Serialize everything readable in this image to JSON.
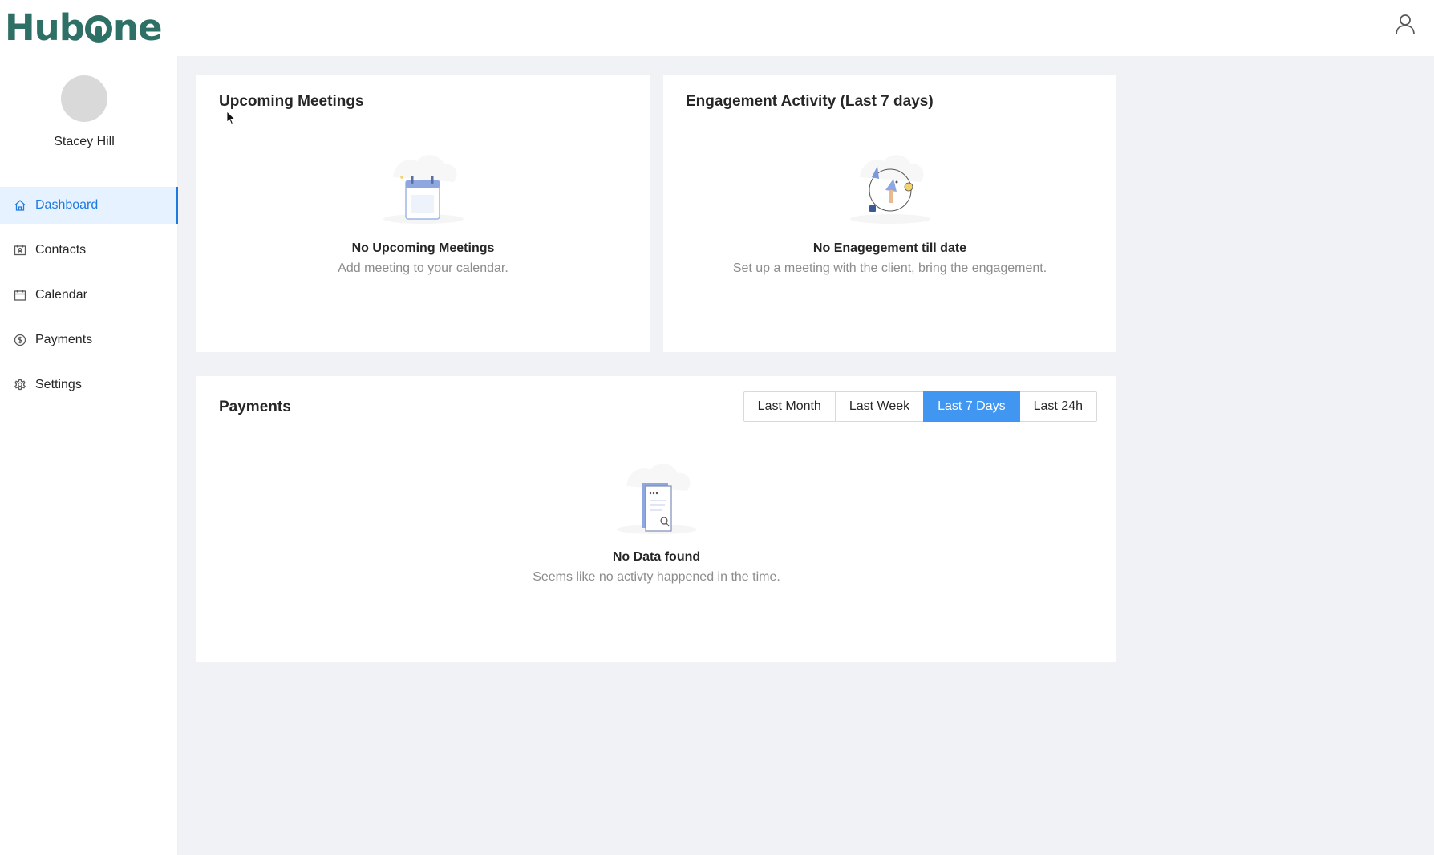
{
  "app": {
    "logo_text_pre": "Hub",
    "logo_text_post": "ne"
  },
  "header": {
    "user_icon": "user-icon"
  },
  "profile": {
    "name": "Stacey Hill"
  },
  "sidebar": {
    "items": [
      {
        "label": "Dashboard",
        "icon": "home-icon",
        "active": true
      },
      {
        "label": "Contacts",
        "icon": "contacts-icon",
        "active": false
      },
      {
        "label": "Calendar",
        "icon": "calendar-icon",
        "active": false
      },
      {
        "label": "Payments",
        "icon": "dollar-icon",
        "active": false
      },
      {
        "label": "Settings",
        "icon": "gear-icon",
        "active": false
      }
    ]
  },
  "meetings": {
    "title": "Upcoming Meetings",
    "empty_title": "No Upcoming Meetings",
    "empty_sub": "Add meeting to your calendar."
  },
  "engagement": {
    "title": "Engagement Activity (Last 7 days)",
    "empty_title": "No Enagegement till date",
    "empty_sub": "Set up a meeting with the client, bring the engagement."
  },
  "payments": {
    "title": "Payments",
    "filters": [
      "Last Month",
      "Last Week",
      "Last 7 Days",
      "Last 24h"
    ],
    "selected_filter": "Last 7 Days",
    "empty_title": "No Data found",
    "empty_sub": "Seems like no activty happened in the time."
  },
  "colors": {
    "brand": "#2e7065",
    "accent": "#1f7ae0",
    "selected_button": "#4096f0",
    "background": "#f0f2f5"
  }
}
